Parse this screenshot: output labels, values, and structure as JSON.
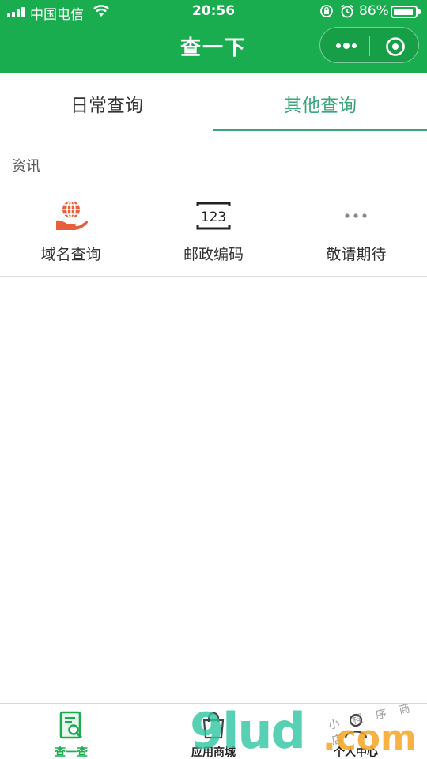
{
  "status_bar": {
    "carrier": "中国电信",
    "time": "20:56",
    "battery_percent": "86%",
    "battery_level": 0.86,
    "icons": [
      "signal-icon",
      "wifi-icon",
      "rotation-lock-icon",
      "alarm-icon",
      "battery-icon"
    ]
  },
  "nav": {
    "title": "查一下",
    "capsule_icons": [
      "more-dots-icon",
      "close-target-icon"
    ]
  },
  "tabs": [
    {
      "label": "日常查询",
      "active": false
    },
    {
      "label": "其他查询",
      "active": true
    }
  ],
  "section": {
    "title": "资讯"
  },
  "grid": [
    {
      "label": "域名查询",
      "icon": "globe-hand-icon"
    },
    {
      "label": "邮政编码",
      "icon": "postcode-123-icon"
    },
    {
      "label": "敬请期待",
      "icon": "ellipsis-icon"
    }
  ],
  "tabbar": [
    {
      "label": "查一查",
      "icon": "search-document-icon",
      "active": true
    },
    {
      "label": "应用商城",
      "icon": "shopping-bag-icon",
      "active": false
    },
    {
      "label": "个人中心",
      "icon": "person-icon",
      "active": false
    }
  ],
  "watermark": {
    "main": "9lud",
    "tld": ".com",
    "small": "小 程 序 商 店"
  },
  "colors": {
    "brand_green": "#1aad4f",
    "tab_active": "#3aa67a",
    "icon_orange": "#e5603b"
  }
}
